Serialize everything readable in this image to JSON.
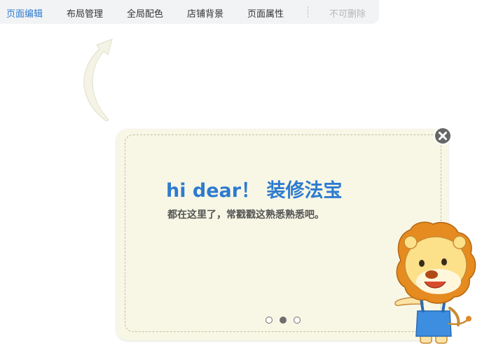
{
  "tabs": [
    {
      "label": "页面编辑",
      "state": "active"
    },
    {
      "label": "布局管理",
      "state": "normal"
    },
    {
      "label": "全局配色",
      "state": "normal"
    },
    {
      "label": "店铺背景",
      "state": "normal"
    },
    {
      "label": "页面属性",
      "state": "normal"
    },
    {
      "label": "不可删除",
      "state": "disabled"
    }
  ],
  "tip": {
    "title": "hi dear！ 装修法宝",
    "subtitle": "都在这里了，常戳戳这熟悉熟悉吧。",
    "pager": {
      "total": 3,
      "current": 2
    }
  },
  "icons": {
    "close": "close-icon",
    "arrow": "curved-arrow-icon",
    "mascot": "lion-mascot"
  },
  "colors": {
    "accent": "#2e7bcf",
    "card_bg": "#f8f7e6",
    "tab_bar_bg": "#f2f3f5",
    "disabled_text": "#b6b6b6"
  }
}
